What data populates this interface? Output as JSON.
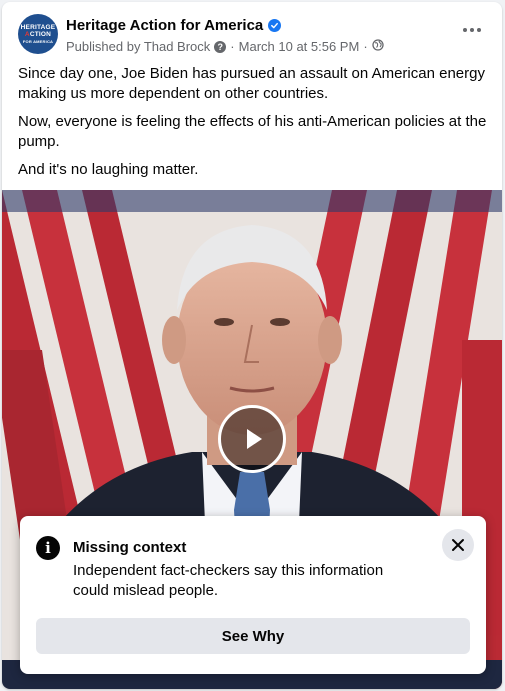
{
  "post": {
    "page_name": "Heritage Action for America",
    "published_by": "Published by Thad Brock",
    "date": "March 10 at 5:56 PM",
    "separator": "·",
    "paragraphs": [
      "Since day one, Joe Biden has pursued an assault on American energy making us more dependent on other countries.",
      "Now, everyone is feeling the effects of his anti-American policies at the pump.",
      "And it's no laughing matter."
    ]
  },
  "avatar": {
    "line1": "HERITAGE",
    "line2_red": "A",
    "line2_rest": "CTION",
    "line3": "FOR AMERICA"
  },
  "icons": {
    "verified": "verified-badge-icon",
    "privacy": "globe-icon",
    "more": "more-options-icon",
    "play": "play-icon",
    "info": "info-icon",
    "close": "close-icon"
  },
  "fact_check": {
    "title": "Missing context",
    "description": "Independent fact-checkers say this information could mislead people.",
    "button_label": "See Why",
    "info_glyph": "i",
    "question_glyph": "?"
  },
  "colors": {
    "brand_blue": "#1877f2",
    "avatar_blue": "#1f4f8f",
    "avatar_red": "#e53935",
    "secondary_text": "#65676b",
    "button_gray": "#e4e6eb"
  }
}
